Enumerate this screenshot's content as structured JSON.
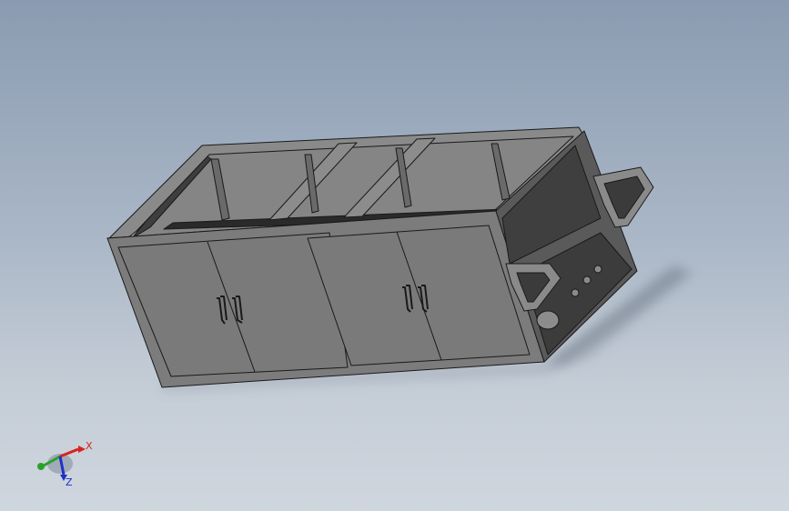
{
  "viewport": {
    "background_top": "#8a9bb1",
    "background_bottom": "#cfd6de"
  },
  "model": {
    "body_color": "#7b7b7b",
    "edge_color": "#1a1a1a"
  },
  "triad": {
    "x_label": "X",
    "z_label": "Z",
    "x_color": "#d8231f",
    "y_color": "#2ba12b",
    "z_color": "#2030c8"
  }
}
